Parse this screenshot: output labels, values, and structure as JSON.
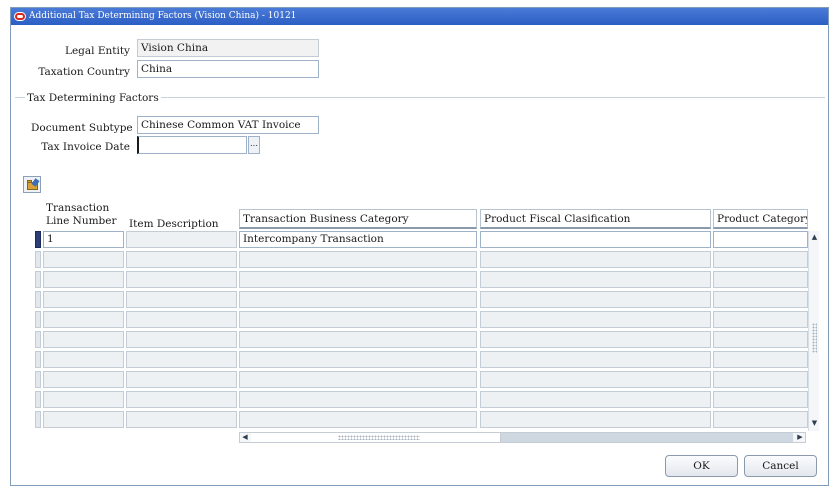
{
  "window": {
    "title": "Additional Tax Determining Factors (Vision China) - 10121"
  },
  "header_fields": {
    "legal_entity_label": "Legal Entity",
    "legal_entity_value": "Vision China",
    "taxation_country_label": "Taxation Country",
    "taxation_country_value": "China"
  },
  "tax_factors": {
    "section_title": "Tax Determining Factors",
    "document_subtype_label": "Document Subtype",
    "document_subtype_value": "Chinese Common VAT Invoice",
    "tax_invoice_date_label": "Tax Invoice Date",
    "tax_invoice_date_value": "",
    "lov_glyph": "…"
  },
  "icons": {
    "folder": "folder-open-icon",
    "scroll_up": "▲",
    "scroll_down": "▼",
    "scroll_left": "◀",
    "scroll_right": "▶"
  },
  "table": {
    "columns": {
      "line_number_line1": "Transaction",
      "line_number_line2": "Line Number",
      "item_description": "Item Description",
      "business_category": "Transaction Business Category",
      "product_fiscal": "Product Fiscal Clasification",
      "product_category": "Product Category"
    },
    "rows": [
      {
        "line_number": "1",
        "item_description": "",
        "business_category": "Intercompany Transaction",
        "product_fiscal": "",
        "product_category": ""
      }
    ]
  },
  "buttons": {
    "ok": "OK",
    "cancel": "Cancel"
  },
  "colors": {
    "titlebar": "#2b5ec4",
    "current_row_indicator": "#2c3e78"
  }
}
